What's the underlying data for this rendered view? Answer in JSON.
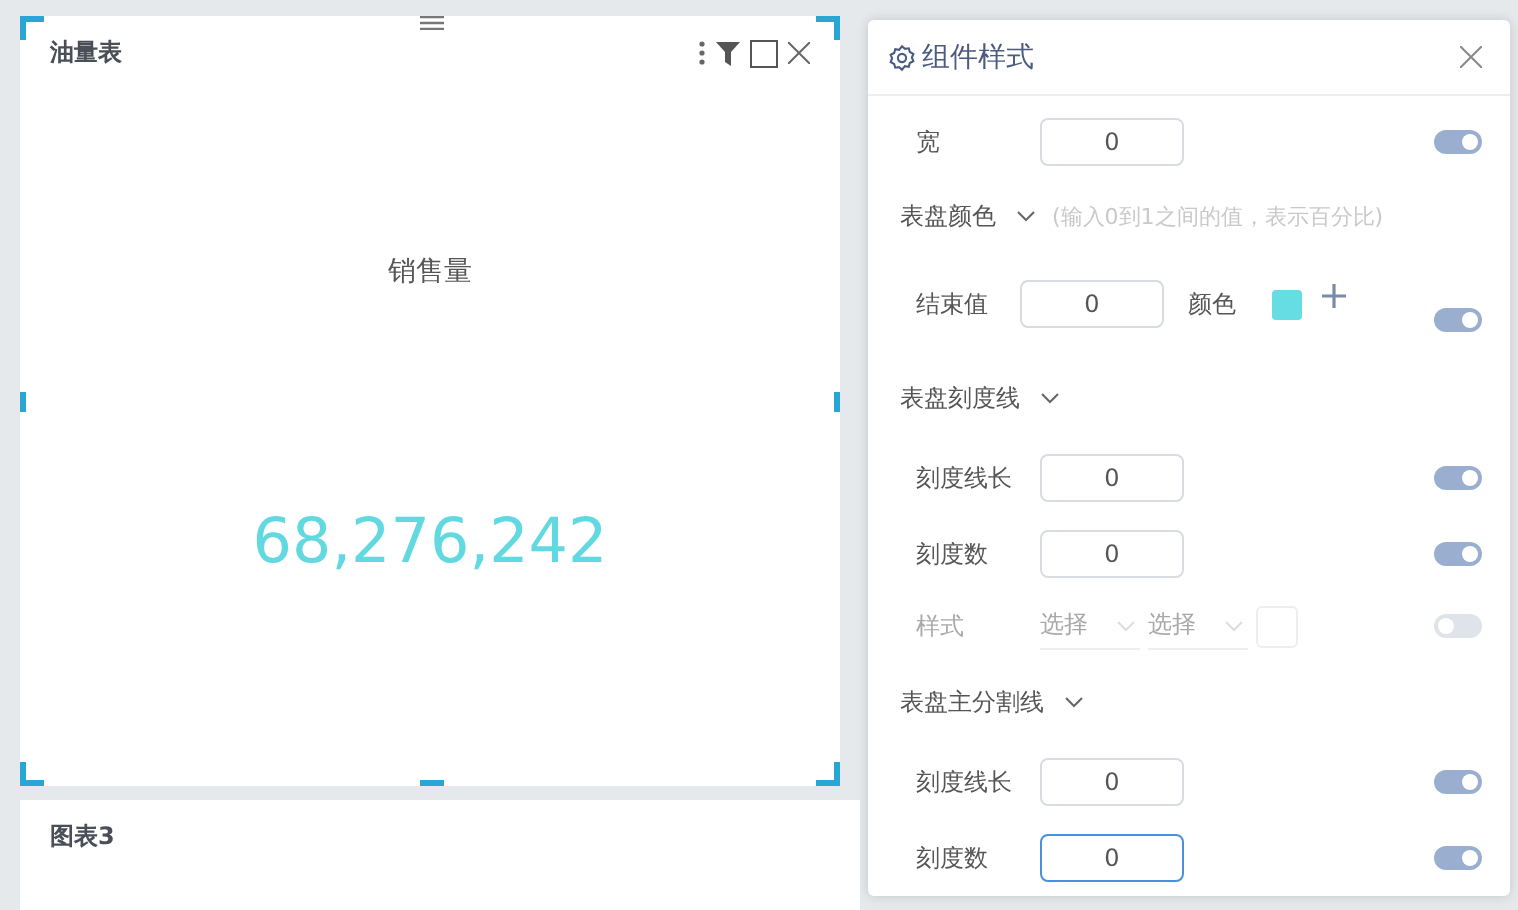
{
  "chart_card": {
    "title": "油量表",
    "metric_label": "销售量",
    "metric_value": "68,276,242"
  },
  "second_card": {
    "title": "图表3"
  },
  "style_panel": {
    "title": "组件样式",
    "rows": [
      {
        "kind": "input",
        "label": "宽",
        "value": "0",
        "on": true,
        "focused": false
      },
      {
        "kind": "section",
        "label": "表盘颜色",
        "hint": "(输入0到1之间的值，表示百分比)"
      },
      {
        "kind": "color",
        "label": "结束值",
        "value": "0",
        "color_label": "颜色",
        "color": "#66dde3",
        "on": true
      },
      {
        "kind": "section",
        "label": "表盘刻度线"
      },
      {
        "kind": "input",
        "label": "刻度线长",
        "value": "0",
        "on": true,
        "focused": false
      },
      {
        "kind": "input",
        "label": "刻度数",
        "value": "0",
        "on": true,
        "focused": false
      },
      {
        "kind": "select",
        "label": "样式",
        "options": [
          "选择",
          "选择"
        ],
        "on": false
      },
      {
        "kind": "section",
        "label": "表盘主分割线"
      },
      {
        "kind": "input",
        "label": "刻度线长",
        "value": "0",
        "on": true,
        "focused": false
      },
      {
        "kind": "input",
        "label": "刻度数",
        "value": "0",
        "on": true,
        "focused": true
      }
    ]
  }
}
